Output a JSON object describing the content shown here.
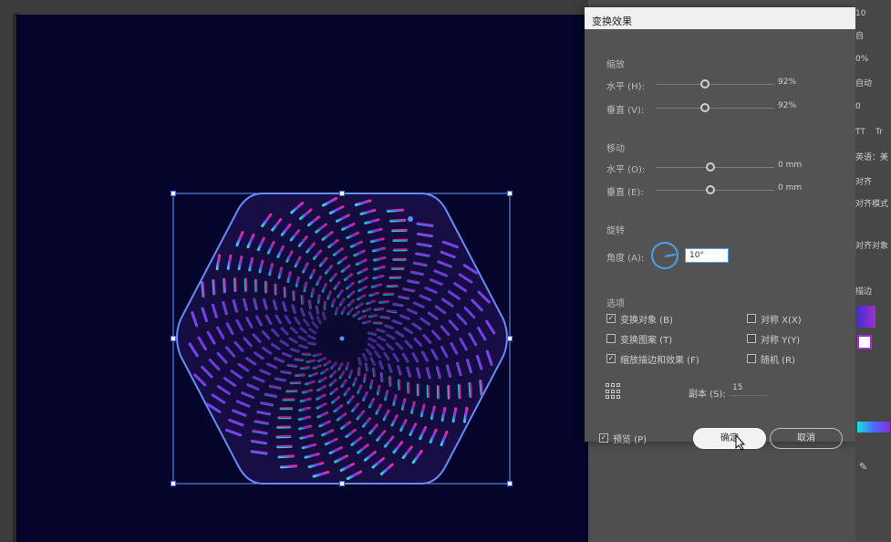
{
  "dialog": {
    "title": "变换效果",
    "scale": {
      "section": "缩放",
      "horizontal_label": "水平 (H):",
      "horizontal_value": "92%",
      "vertical_label": "垂直 (V):",
      "vertical_value": "92%"
    },
    "move": {
      "section": "移动",
      "horizontal_label": "水平 (O):",
      "horizontal_value": "0 mm",
      "vertical_label": "垂直 (E):",
      "vertical_value": "0 mm"
    },
    "rotate": {
      "section": "旋转",
      "angle_label": "角度 (A):",
      "angle_value": "10°"
    },
    "options": {
      "section": "选项",
      "transform_objects": {
        "label": "变换对象 (B)",
        "checked": true
      },
      "transform_patterns": {
        "label": "变换图案 (T)",
        "checked": false
      },
      "scale_strokes": {
        "label": "缩放描边和效果 (F)",
        "checked": true
      },
      "reflect_x": {
        "label": "对称 X(X)",
        "checked": false
      },
      "reflect_y": {
        "label": "对称 Y(Y)",
        "checked": false
      },
      "random": {
        "label": "随机 (R)",
        "checked": false
      }
    },
    "copies_label": "副本 (S):",
    "copies_value": "15",
    "preview": {
      "label": "预览 (P)",
      "checked": true
    },
    "ok_label": "确定",
    "cancel_label": "取消"
  },
  "right_panel": {
    "items": [
      "10",
      "自",
      "0%",
      "自动",
      "0",
      "TT",
      "Tr",
      "英语：美",
      "对齐",
      "对齐模式",
      "对齐对象",
      "描边"
    ]
  },
  "colors": {
    "accent": "#4aa1f2",
    "artboard": "#05052b",
    "spiral_start": "#2ee6e6",
    "spiral_mid": "#7b3cff",
    "spiral_end": "#ff2d95"
  }
}
